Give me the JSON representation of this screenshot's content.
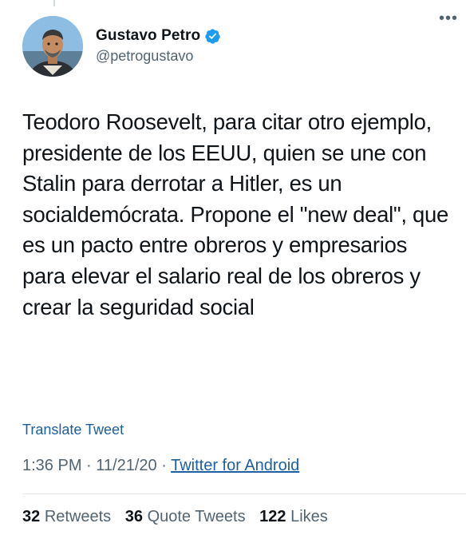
{
  "author": {
    "display_name": "Gustavo Petro",
    "handle": "@petrogustavo",
    "verified": true,
    "avatar_icon": "profile-photo"
  },
  "tweet": {
    "text": "Teodoro Roosevelt, para citar otro ejemplo, presidente de los EEUU, quien se une con Stalin para derrotar a Hitler, es un socialdemócrata. Propone el \"new deal\", que es un pacto entre obreros y empresarios para elevar el salario real de los obreros y crear la seguridad social",
    "translate_label": "Translate Tweet",
    "time": "1:36 PM",
    "separator": "·",
    "date": "11/21/20",
    "source": "Twitter for Android"
  },
  "stats": {
    "retweets_count": "32",
    "retweets_label": "Retweets",
    "quotes_count": "36",
    "quotes_label": "Quote Tweets",
    "likes_count": "122",
    "likes_label": "Likes"
  },
  "colors": {
    "verified_blue": "#1d9bf0",
    "link_blue": "#1d5fa0",
    "secondary_text": "#536471"
  }
}
